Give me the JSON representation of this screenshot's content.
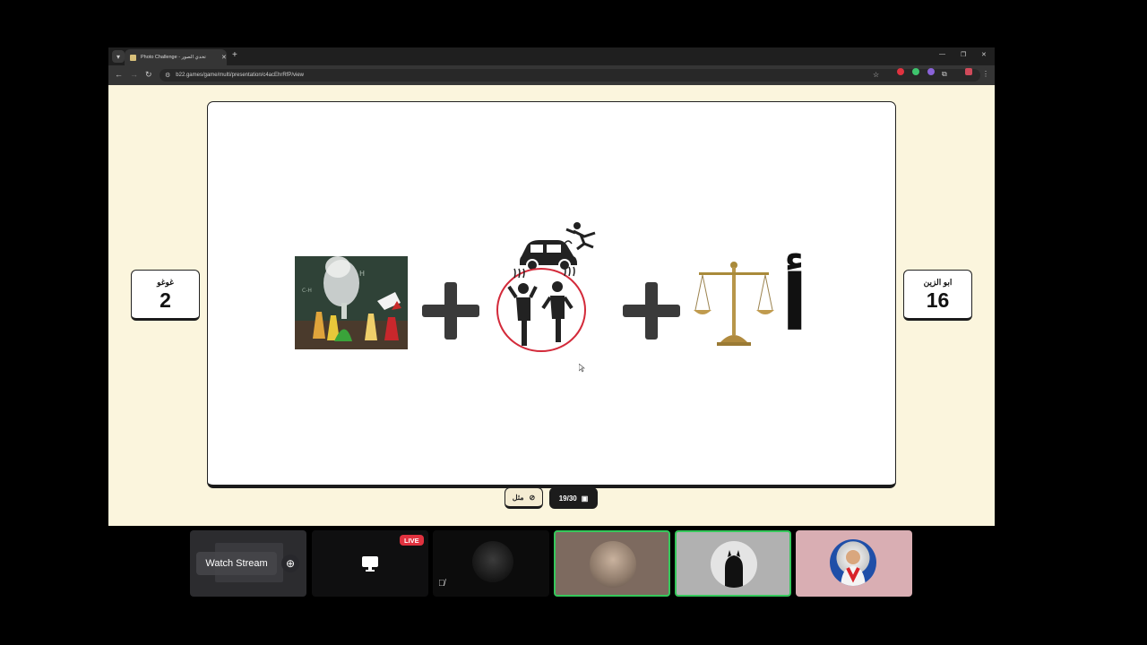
{
  "browser": {
    "tab_title": "Photo Challenge - تحدي الصور",
    "url": "b22.games/game/multi/presentation/c4acEhrRfP/view"
  },
  "game": {
    "left_player": {
      "name": "غوغو",
      "score": "2"
    },
    "right_player": {
      "name": "ابو الزين",
      "score": "16"
    },
    "hint_label": "مثل",
    "round": "19/30",
    "letter": "أ"
  },
  "call": {
    "watch_stream_label": "Watch Stream",
    "live_badge": "LIVE"
  },
  "colors": {
    "page_bg": "#fbf5dd",
    "slide_border": "#1b1b1b",
    "speaking_border": "#35c85b",
    "live_red": "#e0323f"
  },
  "icons": [
    "tab-list-icon",
    "favicon-icon",
    "close-icon",
    "plus-icon",
    "minimize-icon",
    "restore-icon",
    "back-icon",
    "forward-icon",
    "reload-icon",
    "site-info-icon",
    "star-icon",
    "extension-icon",
    "menu-icon",
    "hint-icon",
    "image-icon",
    "screen-share-icon",
    "popout-icon",
    "muted-mic-icon"
  ]
}
